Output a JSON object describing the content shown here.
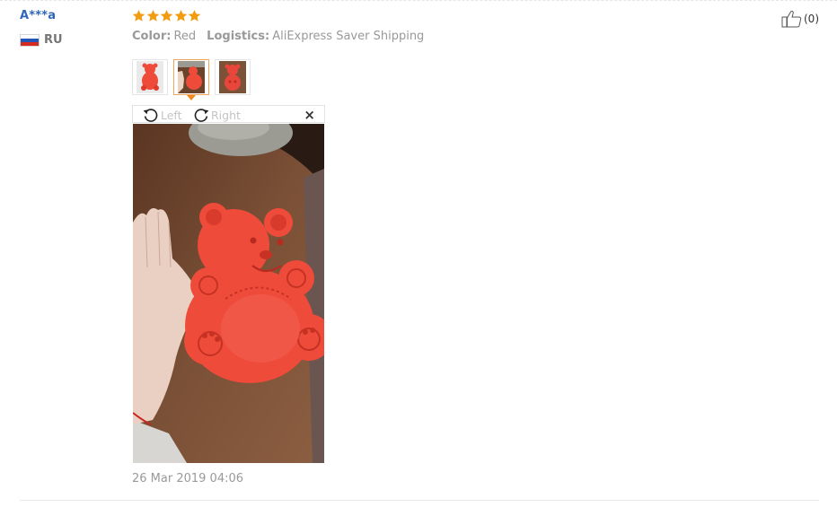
{
  "review": {
    "user_name": "A***a",
    "country_code": "RU",
    "rating": 5,
    "attributes": [
      {
        "label": "Color:",
        "value": "Red"
      },
      {
        "label": "Logistics:",
        "value": "AliExpress Saver Shipping"
      }
    ],
    "helpful_count": "(0)",
    "date": "26 Mar 2019 04:06"
  },
  "viewer": {
    "rotate_left_label": "Left",
    "rotate_right_label": "Right",
    "close_label": "×"
  },
  "thumbnails": [
    {
      "name": "photo-1"
    },
    {
      "name": "photo-2",
      "active": true
    },
    {
      "name": "photo-3"
    }
  ],
  "colors": {
    "user_link": "#2e67b8",
    "star": "#f39c12",
    "active_thumb": "#f0a35a",
    "product": "#ee4b3a"
  },
  "icons": [
    "star-icon",
    "thumbs-up-icon",
    "rotate-left-icon",
    "rotate-right-icon",
    "close-icon",
    "russia-flag-icon"
  ]
}
